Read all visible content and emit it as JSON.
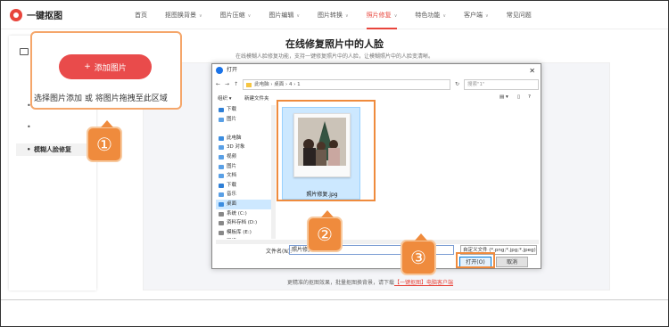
{
  "header": {
    "logo_text": "一键抠图",
    "nav": [
      {
        "label": "首页",
        "dropdown": false
      },
      {
        "label": "抠图换背景",
        "dropdown": true
      },
      {
        "label": "图片压缩",
        "dropdown": true
      },
      {
        "label": "图片编辑",
        "dropdown": true
      },
      {
        "label": "图片转换",
        "dropdown": true
      },
      {
        "label": "照片修复",
        "dropdown": true,
        "active": true
      },
      {
        "label": "特色功能",
        "dropdown": true
      },
      {
        "label": "客户端",
        "dropdown": true
      },
      {
        "label": "常见问题",
        "dropdown": false
      }
    ],
    "accent_color": "#e8453c"
  },
  "sidebar": {
    "active_item": "模糊人脸修复"
  },
  "main": {
    "title": "在线修复照片中的人脸",
    "subtitle": "在线模糊人脸修复功能，支持一键修复照片中的人脸，让模糊照片中的人脸变清晰。",
    "bottom_note": "更精准的抠图效果，批量抠图换背景，请下载",
    "bottom_link": "【一键抠图】电脑客户端"
  },
  "callout": {
    "add_button": "添加图片",
    "drop_hint": "选择图片添加 或 将图片拖拽至此区域"
  },
  "steps": [
    "①",
    "②",
    "③"
  ],
  "dialog": {
    "title": "打开",
    "path": "此电脑 › 桌面 › 4 › 1",
    "search_placeholder": "搜索\"1\"",
    "organize": "组织 ▾",
    "new_folder": "新建文件夹",
    "tree": [
      {
        "label": "下载",
        "color": "#2f7fd6"
      },
      {
        "label": "图片",
        "color": "#5aa0e6"
      },
      {
        "label": "",
        "color": "#ffffff"
      },
      {
        "label": "此电脑",
        "color": "#3c8de0"
      },
      {
        "label": "3D 对象",
        "color": "#5aa0e6"
      },
      {
        "label": "视频",
        "color": "#5aa0e6"
      },
      {
        "label": "图片",
        "color": "#5aa0e6"
      },
      {
        "label": "文档",
        "color": "#5aa0e6"
      },
      {
        "label": "下载",
        "color": "#2f7fd6"
      },
      {
        "label": "音乐",
        "color": "#5aa0e6"
      },
      {
        "label": "桌面",
        "color": "#3c8de0",
        "selected": true
      },
      {
        "label": "系统 (C:)",
        "color": "#888888"
      },
      {
        "label": "资料存档 (D:)",
        "color": "#888888"
      },
      {
        "label": "模板库 (E:)",
        "color": "#888888"
      },
      {
        "label": "网络",
        "color": "#3c8de0"
      }
    ],
    "file_name": "照片修复.jpg",
    "filename_label": "文件名(N):",
    "filename_value": "照片修复",
    "file_type": "自定义文件 (*.png;*.jpg;*.jpeg)",
    "open_button": "打开(O)",
    "cancel_button": "取消"
  },
  "colors": {
    "highlight": "#ef8b3d",
    "button_red": "#e94b4b"
  }
}
